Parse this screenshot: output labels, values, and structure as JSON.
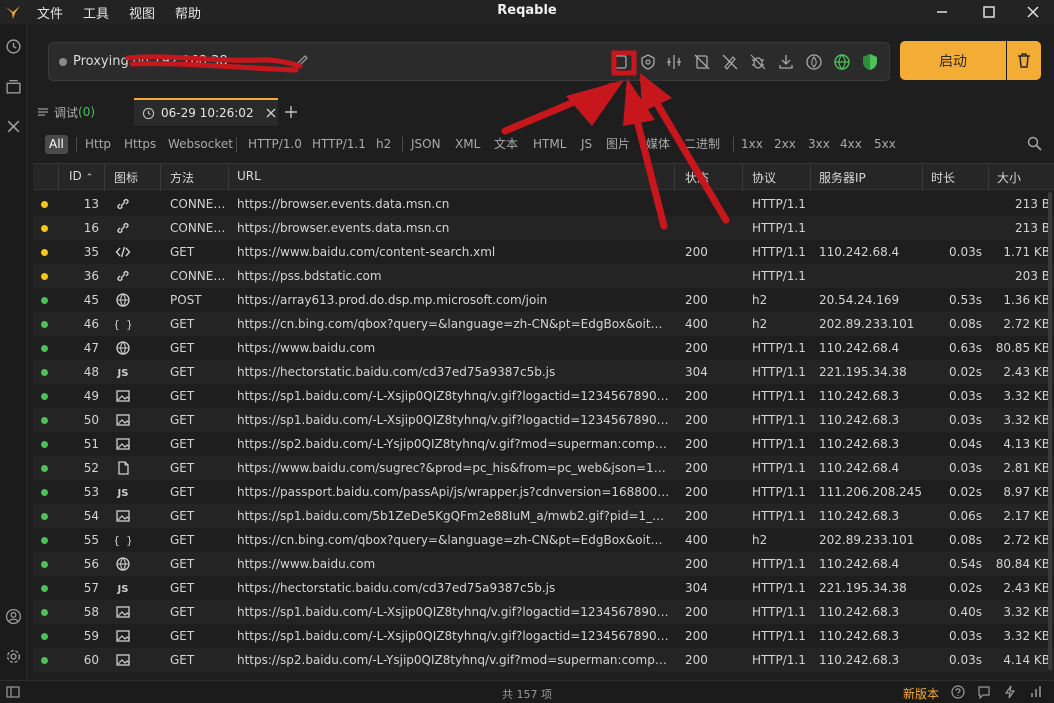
{
  "app": {
    "title": "Reqable",
    "menu": [
      "文件",
      "工具",
      "视图",
      "帮助"
    ]
  },
  "proxy": {
    "status_text": "Proxying on 192.168.38",
    "start_label": "启动"
  },
  "tabs": {
    "debug_label": "调试",
    "debug_count": "(0)",
    "session_label": "06-29 10:26:02"
  },
  "filters": [
    "All",
    "Http",
    "Https",
    "Websocket",
    "HTTP/1.0",
    "HTTP/1.1",
    "h2",
    "JSON",
    "XML",
    "文本",
    "HTML",
    "JS",
    "图片",
    "媒体",
    "二进制",
    "1xx",
    "2xx",
    "3xx",
    "4xx",
    "5xx"
  ],
  "columns": {
    "id": "ID",
    "icon": "图标",
    "method": "方法",
    "url": "URL",
    "status": "状态",
    "protocol": "协议",
    "server_ip": "服务器IP",
    "duration": "时长",
    "size": "大小"
  },
  "colors": {
    "accent": "#f3ad35",
    "pending_dot": "#f5c518",
    "done_dot": "#4cc05a",
    "annotation": "#c8161d"
  },
  "rows": [
    {
      "id": "13",
      "state": "pending",
      "icon": "link-icon",
      "method": "CONNECT",
      "url": "https://browser.events.data.msn.cn",
      "status": "",
      "protocol": "HTTP/1.1",
      "ip": "",
      "duration": "",
      "size": "213 B"
    },
    {
      "id": "16",
      "state": "pending",
      "icon": "link-icon",
      "method": "CONNECT",
      "url": "https://browser.events.data.msn.cn",
      "status": "",
      "protocol": "HTTP/1.1",
      "ip": "",
      "duration": "",
      "size": "213 B"
    },
    {
      "id": "35",
      "state": "pending",
      "icon": "code-icon",
      "method": "GET",
      "url": "https://www.baidu.com/content-search.xml",
      "status": "200",
      "protocol": "HTTP/1.1",
      "ip": "110.242.68.4",
      "duration": "0.03s",
      "size": "1.71 KB"
    },
    {
      "id": "36",
      "state": "pending",
      "icon": "link-icon",
      "method": "CONNECT",
      "url": "https://pss.bdstatic.com",
      "status": "",
      "protocol": "HTTP/1.1",
      "ip": "",
      "duration": "",
      "size": "203 B"
    },
    {
      "id": "45",
      "state": "done",
      "icon": "globe-icon",
      "method": "POST",
      "url": "https://array613.prod.do.dsp.mp.microsoft.com/join",
      "status": "200",
      "protocol": "h2",
      "ip": "20.54.24.169",
      "duration": "0.53s",
      "size": "1.36 KB"
    },
    {
      "id": "46",
      "state": "done",
      "icon": "json-icon",
      "method": "GET",
      "url": "https://cn.bing.com/qbox?query=&language=zh-CN&pt=EdgBox&oit=0&richa...",
      "status": "400",
      "protocol": "h2",
      "ip": "202.89.233.101",
      "duration": "0.08s",
      "size": "2.72 KB"
    },
    {
      "id": "47",
      "state": "done",
      "icon": "globe-icon",
      "method": "GET",
      "url": "https://www.baidu.com",
      "status": "200",
      "protocol": "HTTP/1.1",
      "ip": "110.242.68.4",
      "duration": "0.63s",
      "size": "80.85 KB"
    },
    {
      "id": "48",
      "state": "done",
      "icon": "js-icon",
      "method": "GET",
      "url": "https://hectorstatic.baidu.com/cd37ed75a9387c5b.js",
      "status": "304",
      "protocol": "HTTP/1.1",
      "ip": "221.195.34.38",
      "duration": "0.02s",
      "size": "2.43 KB"
    },
    {
      "id": "49",
      "state": "done",
      "icon": "image-icon",
      "method": "GET",
      "url": "https://sp1.baidu.com/-L-Xsjip0QIZ8tyhnq/v.gif?logactid=1234567890&showTa...",
      "status": "200",
      "protocol": "HTTP/1.1",
      "ip": "110.242.68.3",
      "duration": "0.03s",
      "size": "3.32 KB"
    },
    {
      "id": "50",
      "state": "done",
      "icon": "image-icon",
      "method": "GET",
      "url": "https://sp1.baidu.com/-L-Xsjip0QIZ8tyhnq/v.gif?logactid=1234567890&showTa...",
      "status": "200",
      "protocol": "HTTP/1.1",
      "ip": "110.242.68.3",
      "duration": "0.03s",
      "size": "3.32 KB"
    },
    {
      "id": "51",
      "state": "done",
      "icon": "image-icon",
      "method": "GET",
      "url": "https://sp2.baidu.com/-L-Ysjip0QIZ8tyhnq/v.gif?mod=superman:components&s...",
      "status": "200",
      "protocol": "HTTP/1.1",
      "ip": "110.242.68.3",
      "duration": "0.04s",
      "size": "4.13 KB"
    },
    {
      "id": "52",
      "state": "done",
      "icon": "file-icon",
      "method": "GET",
      "url": "https://www.baidu.com/sugrec?&prod=pc_his&from=pc_web&json=1&sid=36...",
      "status": "200",
      "protocol": "HTTP/1.1",
      "ip": "110.242.68.4",
      "duration": "0.03s",
      "size": "2.81 KB"
    },
    {
      "id": "53",
      "state": "done",
      "icon": "js-icon",
      "method": "GET",
      "url": "https://passport.baidu.com/passApi/js/wrapper.js?cdnversion=1688005650754...",
      "status": "200",
      "protocol": "HTTP/1.1",
      "ip": "111.206.208.245",
      "duration": "0.02s",
      "size": "8.97 KB"
    },
    {
      "id": "54",
      "state": "done",
      "icon": "image-icon",
      "method": "GET",
      "url": "https://sp1.baidu.com/5b1ZeDe5KgQFm2e88IuM_a/mwb2.gif?pid=1_79&lid=0x...",
      "status": "200",
      "protocol": "HTTP/1.1",
      "ip": "110.242.68.3",
      "duration": "0.06s",
      "size": "2.17 KB"
    },
    {
      "id": "55",
      "state": "done",
      "icon": "json-icon",
      "method": "GET",
      "url": "https://cn.bing.com/qbox?query=&language=zh-CN&pt=EdgBox&oit=0&richa...",
      "status": "400",
      "protocol": "h2",
      "ip": "202.89.233.101",
      "duration": "0.08s",
      "size": "2.72 KB"
    },
    {
      "id": "56",
      "state": "done",
      "icon": "globe-icon",
      "method": "GET",
      "url": "https://www.baidu.com",
      "status": "200",
      "protocol": "HTTP/1.1",
      "ip": "110.242.68.4",
      "duration": "0.54s",
      "size": "80.84 KB"
    },
    {
      "id": "57",
      "state": "done",
      "icon": "js-icon",
      "method": "GET",
      "url": "https://hectorstatic.baidu.com/cd37ed75a9387c5b.js",
      "status": "304",
      "protocol": "HTTP/1.1",
      "ip": "221.195.34.38",
      "duration": "0.02s",
      "size": "2.43 KB"
    },
    {
      "id": "58",
      "state": "done",
      "icon": "image-icon",
      "method": "GET",
      "url": "https://sp1.baidu.com/-L-Xsjip0QIZ8tyhnq/v.gif?logactid=1234567890&showTa...",
      "status": "200",
      "protocol": "HTTP/1.1",
      "ip": "110.242.68.3",
      "duration": "0.40s",
      "size": "3.32 KB"
    },
    {
      "id": "59",
      "state": "done",
      "icon": "image-icon",
      "method": "GET",
      "url": "https://sp1.baidu.com/-L-Xsjip0QIZ8tyhnq/v.gif?logactid=1234567890&showTa...",
      "status": "200",
      "protocol": "HTTP/1.1",
      "ip": "110.242.68.3",
      "duration": "0.03s",
      "size": "3.32 KB"
    },
    {
      "id": "60",
      "state": "done",
      "icon": "image-icon",
      "method": "GET",
      "url": "https://sp2.baidu.com/-L-Ysjip0QIZ8tyhnq/v.gif?mod=superman:components&s...",
      "status": "200",
      "protocol": "HTTP/1.1",
      "ip": "110.242.68.3",
      "duration": "0.03s",
      "size": "4.14 KB"
    }
  ],
  "status_bar": {
    "total": "共 157 项",
    "new_version": "新版本"
  }
}
